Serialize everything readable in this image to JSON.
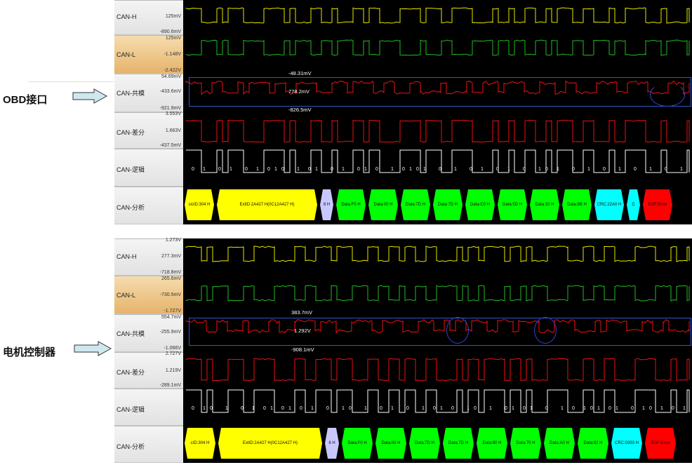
{
  "left_labels": {
    "obd": "OBD接口",
    "motor": "电机控制器"
  },
  "panels": [
    {
      "channels": {
        "can_h": {
          "name": "CAN-H",
          "top": "",
          "mid": "125mV",
          "bot": "-890.6mV"
        },
        "can_l": {
          "name": "CAN-L",
          "top": "125mV",
          "mid": "-1.148V",
          "bot": "-2.422V"
        },
        "common": {
          "name": "CAN-共模",
          "top": "54.69mV",
          "mid": "-433.6mV",
          "bot": "-921.9mV"
        },
        "diff": {
          "name": "CAN-差分",
          "top": "3.553V",
          "mid": "1.663V",
          "bot": "-437.5mV"
        },
        "logic": {
          "name": "CAN-逻辑"
        },
        "analysis": {
          "name": "CAN-分析"
        }
      },
      "measure": {
        "top": "-48.31mV",
        "mid": "778.2mV",
        "bot": "-826.5mV"
      },
      "bits": [
        "0",
        "1",
        "0",
        "1",
        "0|0|1|0|1",
        "0",
        "1",
        "0",
        "1",
        "0",
        "1",
        "0",
        "1",
        "0",
        "1",
        "0",
        "1",
        "0",
        "1",
        "0",
        "1",
        "0",
        "1",
        "0",
        "1",
        "0",
        "1",
        "0",
        "1",
        "0",
        "1",
        "0",
        "1",
        "0",
        "1",
        "0",
        "1",
        "0",
        "1",
        "0",
        "1",
        "0",
        "1"
      ],
      "decode": [
        {
          "label": "sicID:304 H",
          "color": "#ffff00"
        },
        {
          "label": "ExtID:2A427 H(0C12A427 H)",
          "color": "#ffff00"
        },
        {
          "label": "8 H",
          "color": "#c8c8ff"
        },
        {
          "label": "Data:F0 H",
          "color": "#00ff00"
        },
        {
          "label": "Data:00 H",
          "color": "#00ff00"
        },
        {
          "label": "Data:7D H",
          "color": "#00ff00"
        },
        {
          "label": "Data:7D H",
          "color": "#00ff00"
        },
        {
          "label": "Data:C0 H",
          "color": "#00ff00"
        },
        {
          "label": "Data:5D H",
          "color": "#00ff00"
        },
        {
          "label": "Data:10 H",
          "color": "#00ff00"
        },
        {
          "label": "Data:8B H",
          "color": "#00ff00"
        },
        {
          "label": "CRC:22A0 H",
          "color": "#00ffff"
        },
        {
          "label": "C",
          "color": "#00ffff"
        },
        {
          "label": "EOF:Error",
          "color": "#ff0000"
        }
      ]
    },
    {
      "channels": {
        "can_h": {
          "name": "CAN-H",
          "top": "1.273V",
          "mid": "277.3mV",
          "bot": "-718.8mV"
        },
        "can_l": {
          "name": "CAN-L",
          "top": "265.6mV",
          "mid": "-730.5mV",
          "bot": "-1.727V"
        },
        "common": {
          "name": "CAN-共模",
          "top": "554.7mV",
          "mid": "-255.9mV",
          "bot": "-1.066V"
        },
        "diff": {
          "name": "CAN-差分",
          "top": "2.727V",
          "mid": "1.219V",
          "bot": "-289.1mV"
        },
        "logic": {
          "name": "CAN-逻辑"
        },
        "analysis": {
          "name": "CAN-分析"
        }
      },
      "measure": {
        "top": "383.7mV",
        "mid": "1.292V",
        "bot": "-908.1mV"
      },
      "bits": [],
      "decode": [
        {
          "label": "cID:304 H",
          "color": "#ffff00"
        },
        {
          "label": "ExtID:2A427 H(0C12A427 H)",
          "color": "#ffff00"
        },
        {
          "label": "8 H",
          "color": "#c8c8ff"
        },
        {
          "label": "Data:F0 H",
          "color": "#00ff00"
        },
        {
          "label": "Data:00 H",
          "color": "#00ff00"
        },
        {
          "label": "Data:7D H",
          "color": "#00ff00"
        },
        {
          "label": "Data:7D H",
          "color": "#00ff00"
        },
        {
          "label": "Data:80 H",
          "color": "#00ff00"
        },
        {
          "label": "Data:70 H",
          "color": "#00ff00"
        },
        {
          "label": "Data:A0 H",
          "color": "#00ff00"
        },
        {
          "label": "Data:82 H",
          "color": "#00ff00"
        },
        {
          "label": "CRC:0393 H",
          "color": "#00ffff"
        },
        {
          "label": "EOF:Error",
          "color": "#ff0000"
        }
      ]
    }
  ]
}
